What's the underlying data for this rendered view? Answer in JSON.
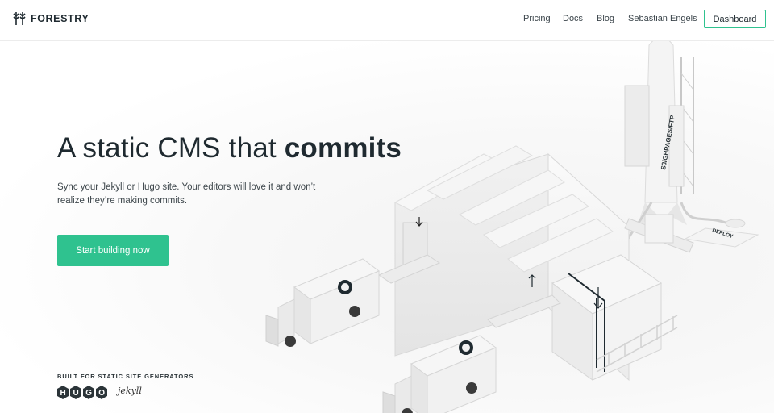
{
  "header": {
    "brand": "FORESTRY",
    "nav": [
      "Pricing",
      "Docs",
      "Blog",
      "Sebastian Engels"
    ],
    "dashboard_label": "Dashboard"
  },
  "hero": {
    "headline_regular": "A static CMS that ",
    "headline_bold": "commits",
    "subtext": "Sync your Jekyll or Hugo site. Your editors will love it and won’t realize they’re making commits.",
    "cta_label": "Start building now",
    "built_for_label": "BUILT FOR STATIC SITE GENERATORS",
    "generators": [
      "HUGO",
      "jekyll"
    ]
  },
  "illustration": {
    "rocket_label": "S3/GHPAGES/FTP",
    "deploy_label": "DEPLOY"
  },
  "colors": {
    "accent": "#2fc28f",
    "text": "#1f2a30"
  }
}
